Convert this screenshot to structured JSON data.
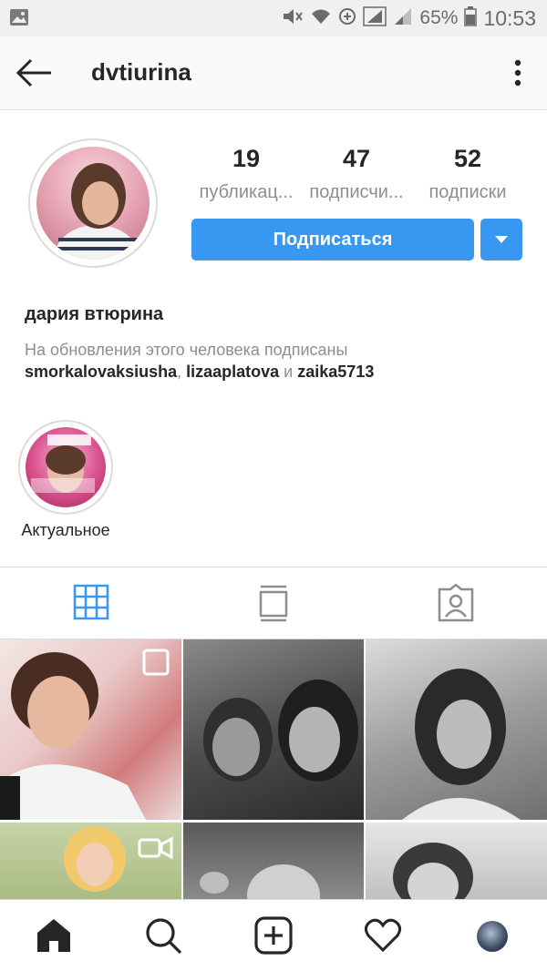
{
  "status_bar": {
    "battery": "65%",
    "time": "10:53"
  },
  "header": {
    "username": "dvtiurina"
  },
  "profile": {
    "stats": [
      {
        "count": "19",
        "label": "публикац..."
      },
      {
        "count": "47",
        "label": "подписчи..."
      },
      {
        "count": "52",
        "label": "подписки"
      }
    ],
    "follow_label": "Подписаться",
    "full_name": "дария втюрина",
    "followed_by_text": "На обновления этого человека подписаны",
    "followed_by_users": [
      "smorkalovaksiusha",
      "lizaaplatova",
      "zaika5713"
    ],
    "followed_by_and": "и"
  },
  "highlights": [
    {
      "label": "Актуальное"
    }
  ],
  "colors": {
    "accent": "#3897f0",
    "text": "#262626",
    "muted": "#8e8e8e",
    "divider": "#dbdbdb"
  },
  "icons": {
    "status_left": "gallery-notification-icon",
    "status_right": [
      "mute-icon",
      "wifi-icon",
      "data-saver-icon",
      "signal-icon",
      "signal-icon",
      "battery-icon"
    ],
    "header": [
      "back-arrow-icon",
      "more-vertical-icon"
    ],
    "tabs": [
      "grid-icon",
      "feed-icon",
      "tagged-icon"
    ],
    "bottom_nav": [
      "home-icon",
      "search-icon",
      "add-post-icon",
      "heart-icon",
      "profile-avatar"
    ]
  }
}
